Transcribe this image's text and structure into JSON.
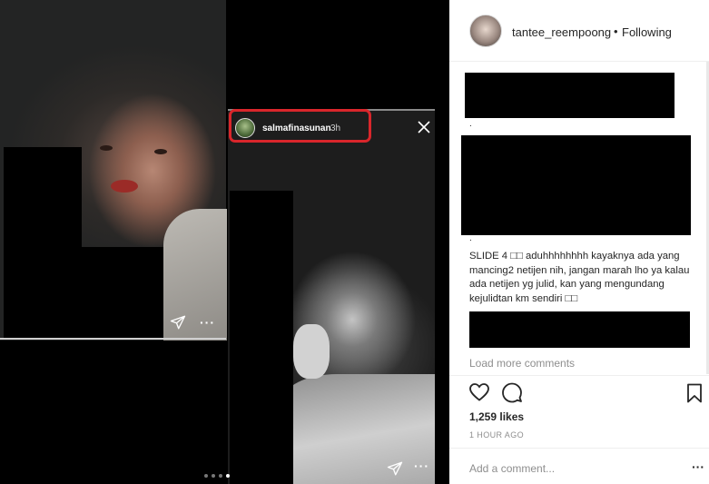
{
  "story_left": {
    "send_icon": "send-plane-icon",
    "more_icon": "more-dots-icon",
    "more_label": "···"
  },
  "story_right": {
    "username": "salmafinasunan",
    "time": "3h",
    "close_icon": "close-icon",
    "send_icon": "send-plane-icon",
    "more_label": "···"
  },
  "post": {
    "username": "tantee_reempoong",
    "separator": "•",
    "follow_status": "Following",
    "comment_text": "SLIDE 4 □□ aduhhhhhhhh kayaknya ada yang mancing2 netijen nih, jangan marah lho ya kalau ada netijen yg julid, kan yang mengundang kejulidtan km sendiri □□",
    "dot": ".",
    "load_more": "Load more comments",
    "likes": "1,259 likes",
    "time_ago": "1 HOUR AGO",
    "add_comment_placeholder": "Add a comment...",
    "more_label": "···"
  },
  "colors": {
    "highlight": "#d9262b",
    "muted_text": "#8e8e8e",
    "text": "#262626"
  }
}
